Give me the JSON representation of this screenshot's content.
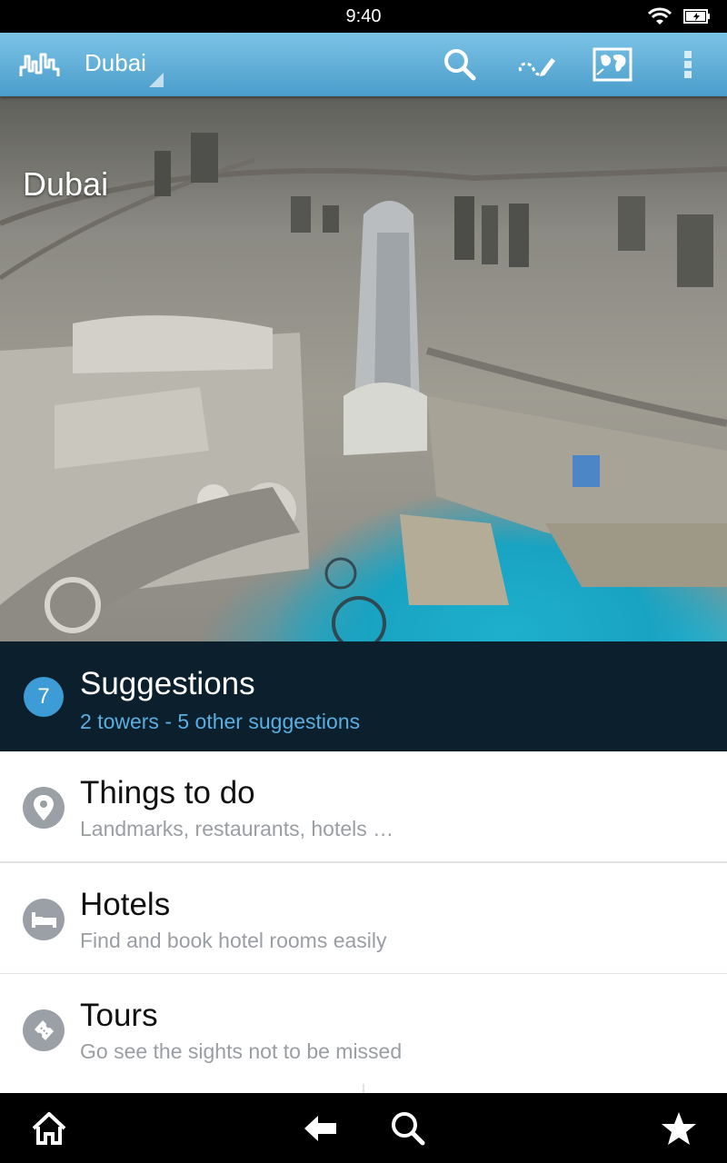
{
  "status_bar": {
    "time": "9:40"
  },
  "action_bar": {
    "city": "Dubai",
    "icons": [
      "search-icon",
      "draw-route-icon",
      "map-icon",
      "overflow-menu-icon"
    ]
  },
  "hero": {
    "title": "Dubai"
  },
  "suggestions": {
    "count": "7",
    "title": "Suggestions",
    "subtitle": "2 towers - 5 other suggestions"
  },
  "list": [
    {
      "title": "Things to do",
      "subtitle": "Landmarks, restaurants, hotels …",
      "icon": "location-pin-icon"
    },
    {
      "title": "Hotels",
      "subtitle": "Find and book hotel rooms easily",
      "icon": "bed-icon"
    },
    {
      "title": "Tours",
      "subtitle": "Go see the sights not to be missed",
      "icon": "ticket-icon"
    }
  ],
  "bottom_nav": {
    "icons": [
      "home-icon",
      "back-icon",
      "search-icon",
      "favorites-star-icon"
    ]
  },
  "colors": {
    "action_bar": "#5aacd8",
    "suggestions_bg": "#0c1f2d",
    "accent": "#3d9bd6",
    "row_icon": "#9aa0a6"
  }
}
